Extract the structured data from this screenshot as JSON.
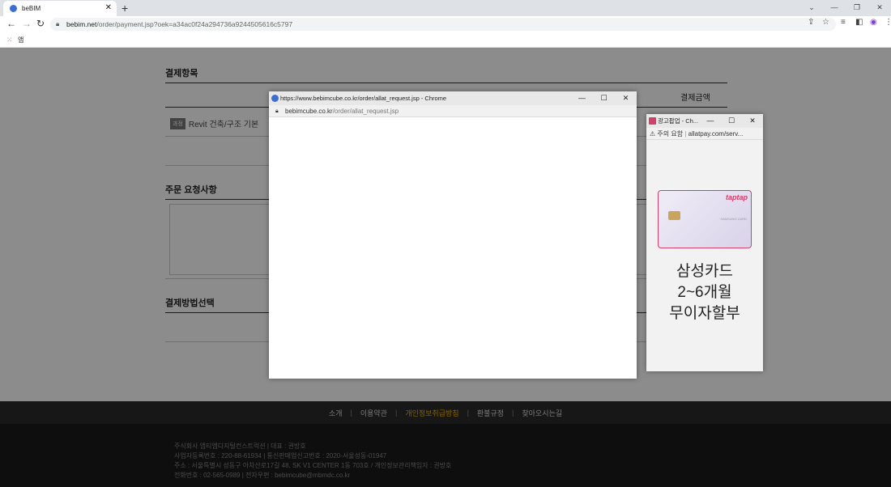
{
  "browser": {
    "tab_title": "beBIM",
    "url_host": "bebim.net",
    "url_path": "/order/payment.jsp?oek=a34ac0f24a294736a9244505616c5797",
    "bookmark_label": "앱"
  },
  "page": {
    "section_payment_items": "결제항목",
    "col_amount": "결제금액",
    "course_tag": "과정",
    "course_name": "Revit 건축/구조 기본",
    "section_order_request": "주문 요청사항",
    "section_payment_method": "결제방법선택"
  },
  "footer": {
    "nav": [
      "소개",
      "이용약관",
      "개인정보취급방침",
      "환불규정",
      "찾아오시는길"
    ],
    "highlight_index": 2,
    "info": [
      "주식회사 엠티엠디지털컨스트럭션 | 대표 : 권방호",
      "사업자등록번호 : 220-88-61934 | 통신판매업신고번호 : 2020-서울성동-01947",
      "주소 : 서울특별시 성동구 아차산로17길 48, SK V1 CENTER 1동 703호 / 개인정보관리책임자 : 권방호",
      "전화번호 : 02-565-0989 | 전자우편 : bebimcube@mbmdc.co.kr"
    ]
  },
  "popup_main": {
    "title": "https://www.bebimcube.co.kr/order/allat_request.jsp - Chrome",
    "addr_host": "bebimcube.co.kr",
    "addr_path": "/order/allat_request.jsp"
  },
  "popup_ad": {
    "title": "광고팝업 - Ch...",
    "warning": "주의 요함",
    "addr": "allatpay.com/serv...",
    "card_brand": "taptap",
    "card_name": "SAMSUNG CARD",
    "ad_line1": "삼성카드",
    "ad_line2": "2~6개월",
    "ad_line3": "무이자할부"
  }
}
